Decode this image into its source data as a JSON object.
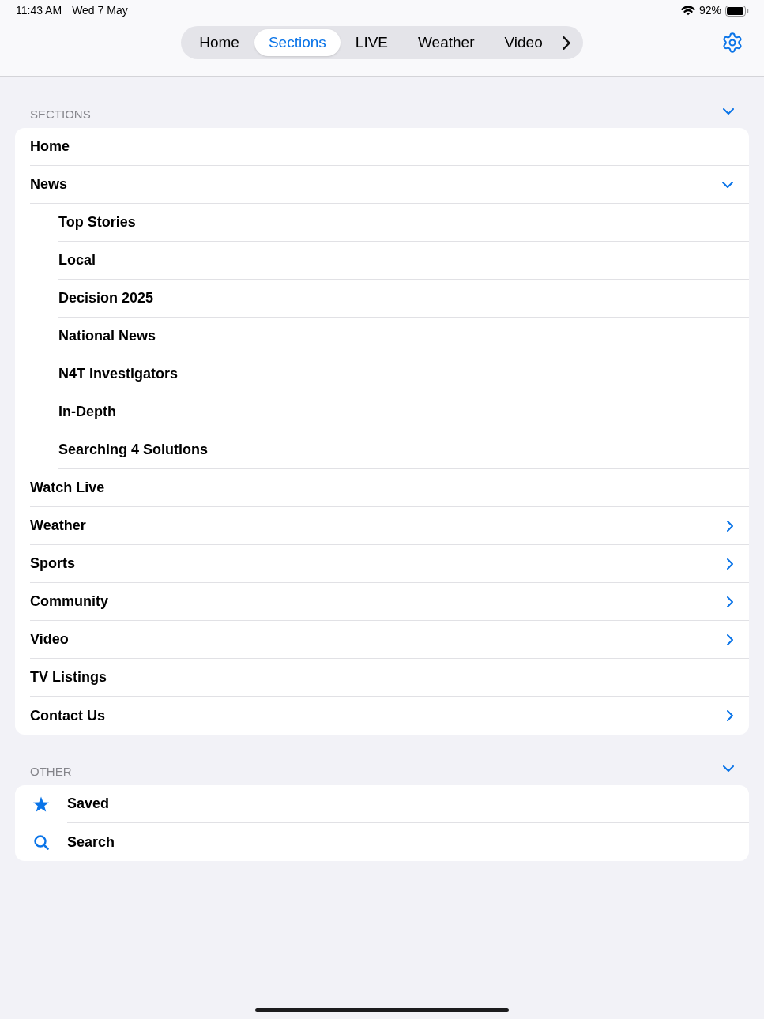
{
  "status_bar": {
    "time": "11:43 AM",
    "date": "Wed 7 May",
    "battery": "92%"
  },
  "tabs": [
    {
      "label": "Home",
      "selected": false
    },
    {
      "label": "Sections",
      "selected": true
    },
    {
      "label": "LIVE",
      "selected": false
    },
    {
      "label": "Weather",
      "selected": false
    },
    {
      "label": "Video",
      "selected": false
    }
  ],
  "groups": [
    {
      "title": "SECTIONS",
      "expanded": true,
      "items": [
        {
          "label": "Home",
          "kind": "page"
        },
        {
          "label": "News",
          "kind": "menu",
          "expanded": true,
          "children": [
            {
              "label": "Top Stories",
              "kind": "page"
            },
            {
              "label": "Local",
              "kind": "page"
            },
            {
              "label": "Decision 2025",
              "kind": "page"
            },
            {
              "label": "National News",
              "kind": "page"
            },
            {
              "label": "N4T Investigators",
              "kind": "page"
            },
            {
              "label": "In-Depth",
              "kind": "page"
            },
            {
              "label": "Searching 4 Solutions",
              "kind": "page"
            }
          ]
        },
        {
          "label": "Watch Live",
          "kind": "page"
        },
        {
          "label": "Weather",
          "kind": "menu",
          "expanded": false
        },
        {
          "label": "Sports",
          "kind": "menu",
          "expanded": false
        },
        {
          "label": "Community",
          "kind": "menu",
          "expanded": false
        },
        {
          "label": "Video",
          "kind": "menu",
          "expanded": false
        },
        {
          "label": "TV Listings",
          "kind": "page"
        },
        {
          "label": "Contact Us",
          "kind": "menu",
          "expanded": false
        }
      ]
    },
    {
      "title": "OTHER",
      "expanded": true,
      "items": [
        {
          "label": "Saved",
          "kind": "shortcut"
        },
        {
          "label": "Search",
          "kind": "shortcut"
        }
      ]
    }
  ]
}
